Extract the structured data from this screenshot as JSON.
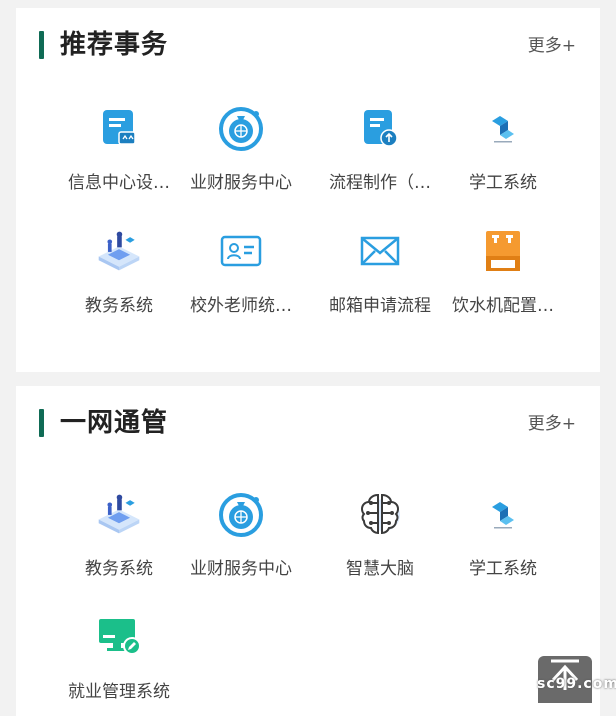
{
  "sections": [
    {
      "title": "推荐事务",
      "more": "更多+",
      "items": [
        {
          "label": "信息中心设…",
          "icon": "document-tag-icon"
        },
        {
          "label": "业财服务中心",
          "icon": "money-bag-globe-icon"
        },
        {
          "label": "流程制作（…",
          "icon": "document-upload-icon"
        },
        {
          "label": "学工系统",
          "icon": "cube-logo-icon"
        },
        {
          "label": "教务系统",
          "icon": "isometric-people-icon"
        },
        {
          "label": "校外老师统…",
          "icon": "id-card-icon"
        },
        {
          "label": "邮箱申请流程",
          "icon": "envelope-icon"
        },
        {
          "label": "饮水机配置…",
          "icon": "water-dispenser-icon"
        }
      ]
    },
    {
      "title": "一网通管",
      "more": "更多+",
      "items": [
        {
          "label": "教务系统",
          "icon": "isometric-people-icon"
        },
        {
          "label": "业财服务中心",
          "icon": "money-bag-globe-icon"
        },
        {
          "label": "智慧大脑",
          "icon": "brain-circuit-icon"
        },
        {
          "label": "学工系统",
          "icon": "cube-logo-icon"
        },
        {
          "label": "就业管理系统",
          "icon": "monitor-edit-icon"
        }
      ]
    }
  ],
  "watermark": "sc99.com",
  "colors": {
    "accent": "#0f6b55",
    "icon_blue": "#2a9ee0",
    "orange": "#f59a30",
    "green": "#1bbf8a"
  }
}
